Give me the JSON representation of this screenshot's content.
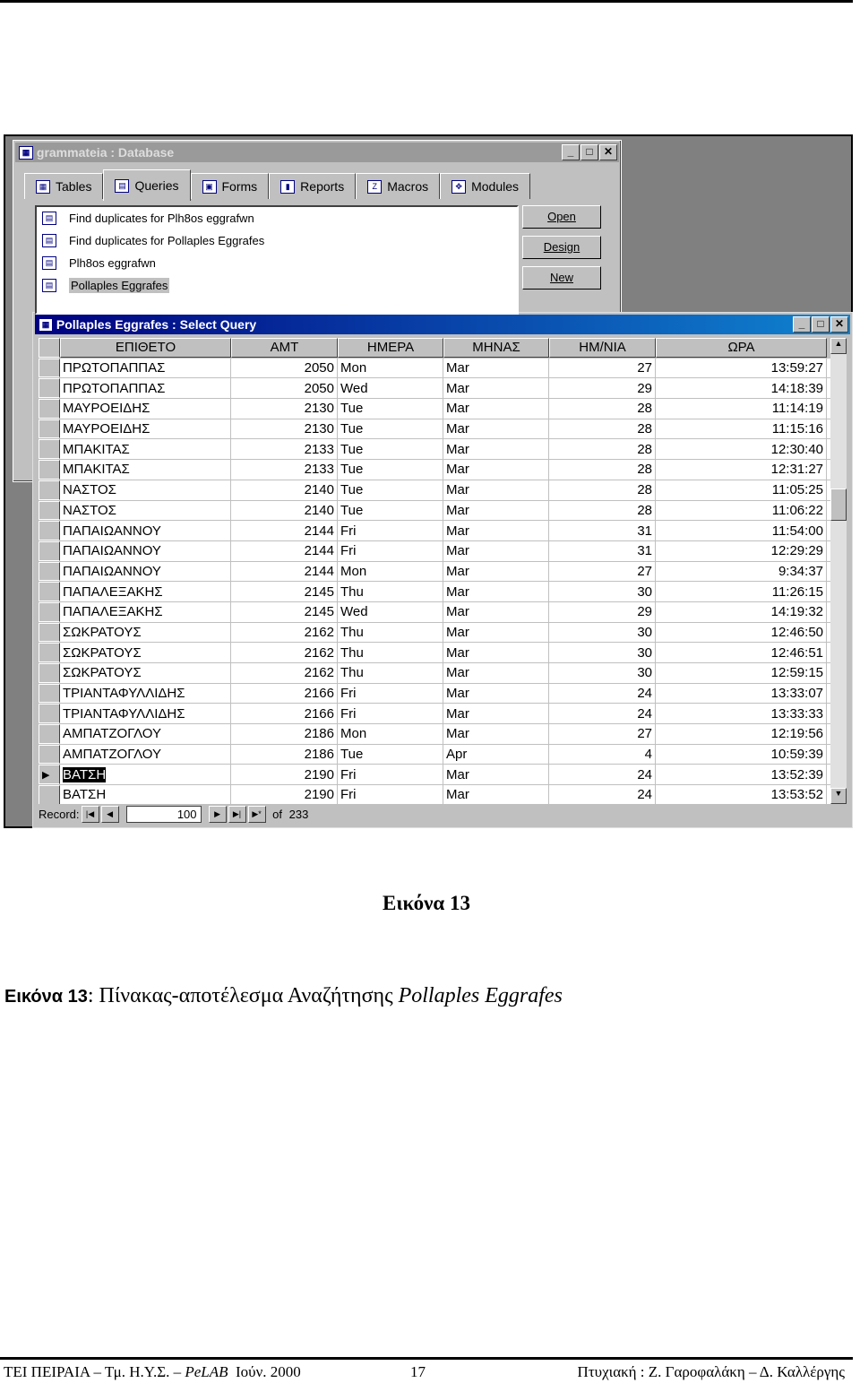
{
  "db_window": {
    "title": "grammateia : Database",
    "tabs": [
      {
        "label": "Tables",
        "icon": "table-icon"
      },
      {
        "label": "Queries",
        "icon": "query-icon",
        "active": true
      },
      {
        "label": "Forms",
        "icon": "form-icon"
      },
      {
        "label": "Reports",
        "icon": "report-icon"
      },
      {
        "label": "Macros",
        "icon": "macro-icon"
      },
      {
        "label": "Modules",
        "icon": "module-icon"
      }
    ],
    "queries": [
      "Find duplicates for Plh8os eggrafwn",
      "Find duplicates for Pollaples Eggrafes",
      "Plh8os eggrafwn",
      "Pollaples Eggrafes"
    ],
    "selected_query": "Pollaples Eggrafes",
    "buttons": {
      "open": "Open",
      "design": "Design",
      "new": "New"
    }
  },
  "query_window": {
    "title": "Pollaples Eggrafes : Select Query",
    "columns": [
      "ΕΠΙΘΕΤΟ",
      "AMT",
      "ΗΜΕΡΑ",
      "ΜΗΝΑΣ",
      "ΗΜ/ΝΙΑ",
      "ΩΡΑ"
    ],
    "rows": [
      [
        "ΠΡΩΤΟΠΑΠΠΑΣ",
        "2050",
        "Mon",
        "Mar",
        "27",
        "13:59:27"
      ],
      [
        "ΠΡΩΤΟΠΑΠΠΑΣ",
        "2050",
        "Wed",
        "Mar",
        "29",
        "14:18:39"
      ],
      [
        "ΜΑΥΡΟΕΙΔΗΣ",
        "2130",
        "Tue",
        "Mar",
        "28",
        "11:14:19"
      ],
      [
        "ΜΑΥΡΟΕΙΔΗΣ",
        "2130",
        "Tue",
        "Mar",
        "28",
        "11:15:16"
      ],
      [
        "ΜΠΑΚΙΤΑΣ",
        "2133",
        "Tue",
        "Mar",
        "28",
        "12:30:40"
      ],
      [
        "ΜΠΑΚΙΤΑΣ",
        "2133",
        "Tue",
        "Mar",
        "28",
        "12:31:27"
      ],
      [
        "ΝΑΣΤΟΣ",
        "2140",
        "Tue",
        "Mar",
        "28",
        "11:05:25"
      ],
      [
        "ΝΑΣΤΟΣ",
        "2140",
        "Tue",
        "Mar",
        "28",
        "11:06:22"
      ],
      [
        "ΠΑΠΑΙΩΑΝΝΟΥ",
        "2144",
        "Fri",
        "Mar",
        "31",
        "11:54:00"
      ],
      [
        "ΠΑΠΑΙΩΑΝΝΟΥ",
        "2144",
        "Fri",
        "Mar",
        "31",
        "12:29:29"
      ],
      [
        "ΠΑΠΑΙΩΑΝΝΟΥ",
        "2144",
        "Mon",
        "Mar",
        "27",
        "9:34:37"
      ],
      [
        "ΠΑΠΑΛΕΞΑΚΗΣ",
        "2145",
        "Thu",
        "Mar",
        "30",
        "11:26:15"
      ],
      [
        "ΠΑΠΑΛΕΞΑΚΗΣ",
        "2145",
        "Wed",
        "Mar",
        "29",
        "14:19:32"
      ],
      [
        "ΣΩΚΡΑΤΟΥΣ",
        "2162",
        "Thu",
        "Mar",
        "30",
        "12:46:50"
      ],
      [
        "ΣΩΚΡΑΤΟΥΣ",
        "2162",
        "Thu",
        "Mar",
        "30",
        "12:46:51"
      ],
      [
        "ΣΩΚΡΑΤΟΥΣ",
        "2162",
        "Thu",
        "Mar",
        "30",
        "12:59:15"
      ],
      [
        "ΤΡΙΑΝΤΑΦΥΛΛΙΔΗΣ",
        "2166",
        "Fri",
        "Mar",
        "24",
        "13:33:07"
      ],
      [
        "ΤΡΙΑΝΤΑΦΥΛΛΙΔΗΣ",
        "2166",
        "Fri",
        "Mar",
        "24",
        "13:33:33"
      ],
      [
        "ΑΜΠΑΤΖΟΓΛΟΥ",
        "2186",
        "Mon",
        "Mar",
        "27",
        "12:19:56"
      ],
      [
        "ΑΜΠΑΤΖΟΓΛΟΥ",
        "2186",
        "Tue",
        "Apr",
        "4",
        "10:59:39"
      ],
      [
        "ΒΑΤΣΗ",
        "2190",
        "Fri",
        "Mar",
        "24",
        "13:52:39"
      ],
      [
        "ΒΑΤΣΗ",
        "2190",
        "Fri",
        "Mar",
        "24",
        "13:53:52"
      ]
    ],
    "current_row": 20,
    "record_nav": {
      "label": "Record:",
      "current": "100",
      "of_label": "of",
      "total": "233"
    }
  },
  "caption_title": "Εικόνα 13",
  "caption": {
    "prefix": "Εικόνα 13",
    "colon": ":",
    "text": " Πίνακας-αποτέλεσμα Αναζήτησης ",
    "italic": "Pollaples Eggrafes"
  },
  "footer": {
    "left": "ΤΕΙ ΠΕΙΡΑΙΑ – Τμ. Η.Υ.Σ. – ",
    "left_italic": "PeLAB",
    "left_date": "Ιούν. 2000",
    "page": "17",
    "right": "Πτυχιακή : Ζ. Γαροφαλάκη – Δ. Καλλέργης"
  }
}
